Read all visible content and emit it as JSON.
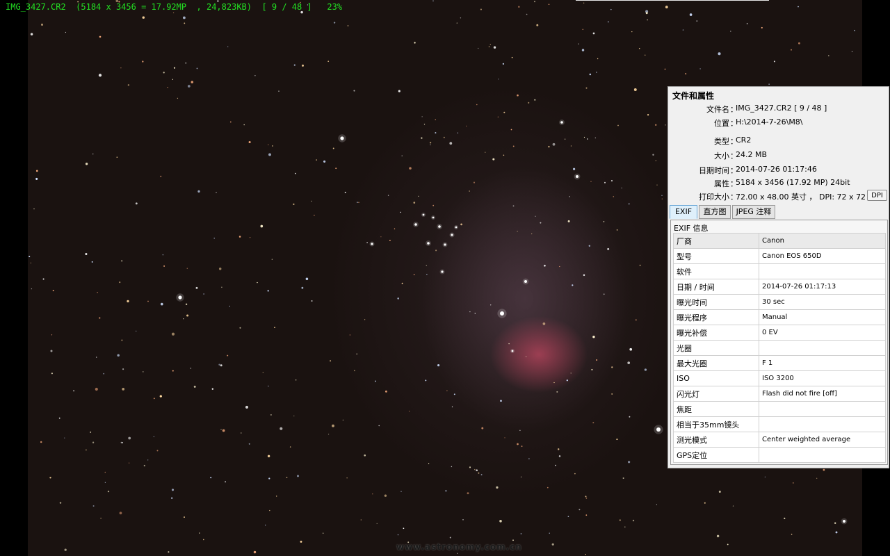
{
  "osd": {
    "text": "IMG_3427.CR2  (5184 x 3456 = 17.92MP  , 24,823KB)  [ 9 / 48 ]   23%",
    "color": "#22e022"
  },
  "watermark": {
    "text": "www.astronomy.com.cn"
  },
  "panel": {
    "title": "文件和属性",
    "rows": [
      {
        "label": "文件名",
        "value": "IMG_3427.CR2   [ 9 / 48 ]"
      },
      {
        "label": "位置",
        "value": "H:\\2014-7-26\\M8\\"
      },
      {
        "label": "类型",
        "value": "CR2"
      },
      {
        "label": "大小",
        "value": "24.2 MB"
      },
      {
        "label": "日期时间",
        "value": "2014-07-26 01:17:46"
      },
      {
        "label": "属性",
        "value": "5184 x 3456 (17.92 MP)  24bit"
      },
      {
        "label": "打印大小",
        "value": "72.00 x 48.00 英寸 ，  DPI: 72 x 72"
      }
    ],
    "colon": "：",
    "dpi_button": "DPI",
    "tabs": [
      {
        "label": "EXIF",
        "active": true
      },
      {
        "label": "直方图",
        "active": false
      },
      {
        "label": "JPEG 注释",
        "active": false
      }
    ],
    "exif": {
      "header": "EXIF 信息",
      "rows": [
        {
          "key": "厂商",
          "value": "Canon"
        },
        {
          "key": "型号",
          "value": "Canon EOS 650D"
        },
        {
          "key": "软件",
          "value": ""
        },
        {
          "key": "日期 / 时间",
          "value": "2014-07-26 01:17:13"
        },
        {
          "key": "曝光时间",
          "value": "30 sec"
        },
        {
          "key": "曝光程序",
          "value": "Manual"
        },
        {
          "key": "曝光补偿",
          "value": "0 EV"
        },
        {
          "key": "光圈",
          "value": ""
        },
        {
          "key": "最大光圈",
          "value": "F 1"
        },
        {
          "key": "ISO",
          "value": "ISO 3200"
        },
        {
          "key": "闪光灯",
          "value": "Flash did not fire [off]"
        },
        {
          "key": "焦距",
          "value": ""
        },
        {
          "key": "相当于35mm镜头",
          "value": ""
        },
        {
          "key": "测光模式",
          "value": "Center weighted average"
        },
        {
          "key": "GPS定位",
          "value": ""
        }
      ]
    }
  }
}
